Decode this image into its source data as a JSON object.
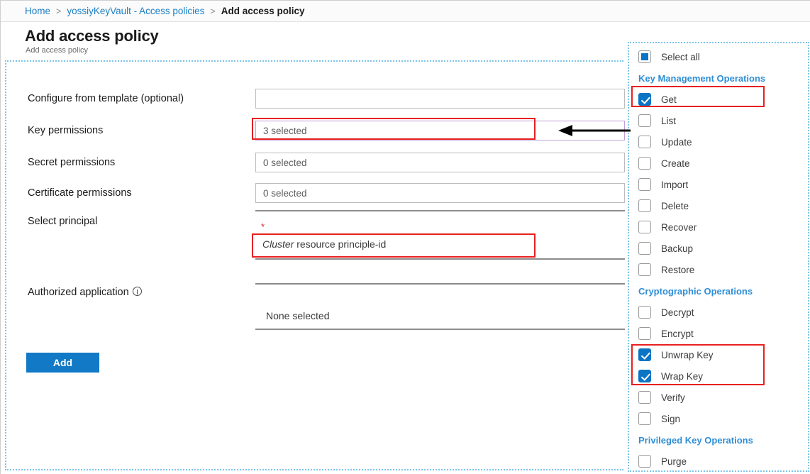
{
  "breadcrumb": {
    "items": [
      {
        "label": "Home",
        "current": false
      },
      {
        "label": "yossiyKeyVault - Access policies",
        "current": false
      },
      {
        "label": "Add access policy",
        "current": true
      }
    ],
    "separator": ">"
  },
  "header": {
    "title": "Add access policy",
    "subtitle": "Add access policy"
  },
  "form": {
    "fields": [
      {
        "label": "Configure from template (optional)",
        "value": ""
      },
      {
        "label": "Key permissions",
        "value": "3 selected"
      },
      {
        "label": "Secret permissions",
        "value": "0 selected"
      },
      {
        "label": "Certificate permissions",
        "value": "0 selected"
      }
    ],
    "select_principal": {
      "label": "Select principal",
      "required_marker": "*",
      "value_italic": "Cluster",
      "value_rest": " resource principle-id"
    },
    "authorized_application": {
      "label": "Authorized application",
      "info_icon": "info-icon",
      "value": "None selected"
    },
    "add_button": "Add"
  },
  "permissions_panel": {
    "select_all": {
      "label": "Select all",
      "state": "indeterminate"
    },
    "groups": [
      {
        "title": "Key Management Operations",
        "items": [
          {
            "label": "Get",
            "checked": true
          },
          {
            "label": "List",
            "checked": false
          },
          {
            "label": "Update",
            "checked": false
          },
          {
            "label": "Create",
            "checked": false
          },
          {
            "label": "Import",
            "checked": false
          },
          {
            "label": "Delete",
            "checked": false
          },
          {
            "label": "Recover",
            "checked": false
          },
          {
            "label": "Backup",
            "checked": false
          },
          {
            "label": "Restore",
            "checked": false
          }
        ]
      },
      {
        "title": "Cryptographic Operations",
        "items": [
          {
            "label": "Decrypt",
            "checked": false
          },
          {
            "label": "Encrypt",
            "checked": false
          },
          {
            "label": "Unwrap Key",
            "checked": true
          },
          {
            "label": "Wrap Key",
            "checked": true
          },
          {
            "label": "Verify",
            "checked": false
          },
          {
            "label": "Sign",
            "checked": false
          }
        ]
      },
      {
        "title": "Privileged Key Operations",
        "items": [
          {
            "label": "Purge",
            "checked": false
          }
        ]
      }
    ]
  },
  "colors": {
    "accent_blue": "#0c74c4",
    "link_blue": "#1c7fc4",
    "group_header_blue": "#2f8ed6",
    "annotation_red": "#e8201f",
    "focus_purple": "#c29fd6",
    "required_red": "#c72b2b"
  }
}
